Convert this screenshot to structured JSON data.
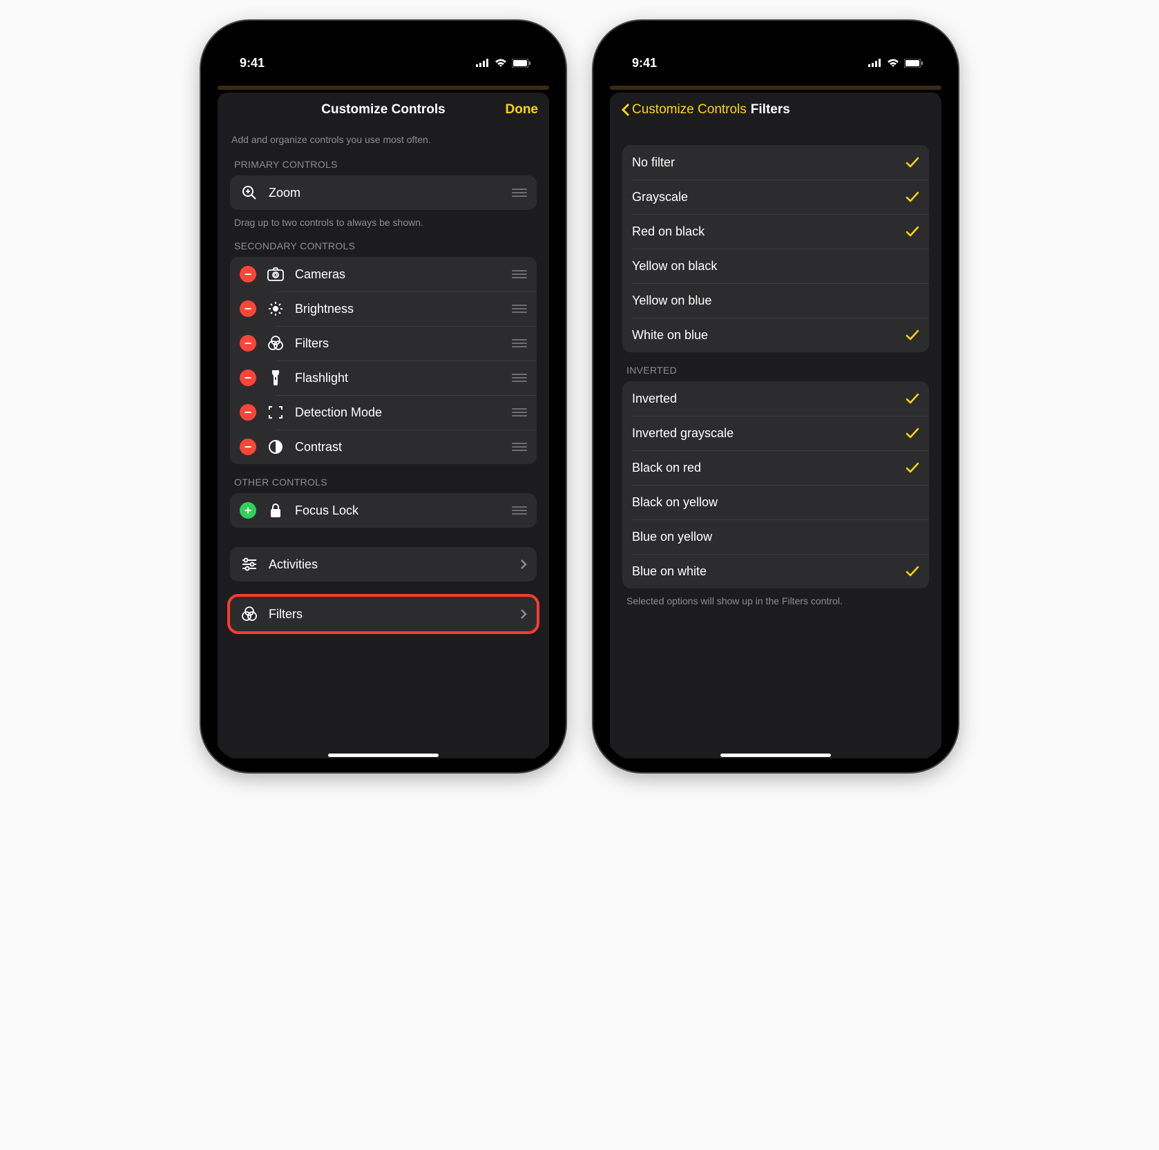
{
  "status": {
    "time": "9:41"
  },
  "left": {
    "title": "Customize Controls",
    "done": "Done",
    "intro": "Add and organize controls you use most often.",
    "primary": {
      "header": "PRIMARY CONTROLS",
      "item": "Zoom",
      "footer": "Drag up to two controls to always be shown."
    },
    "secondary": {
      "header": "SECONDARY CONTROLS",
      "items": [
        "Cameras",
        "Brightness",
        "Filters",
        "Flashlight",
        "Detection Mode",
        "Contrast"
      ]
    },
    "other": {
      "header": "OTHER CONTROLS",
      "item": "Focus Lock"
    },
    "activities": "Activities",
    "filters": "Filters"
  },
  "right": {
    "back": "Customize Controls",
    "title": "Filters",
    "group1": [
      {
        "label": "No filter",
        "checked": true
      },
      {
        "label": "Grayscale",
        "checked": true
      },
      {
        "label": "Red on black",
        "checked": true
      },
      {
        "label": "Yellow on black",
        "checked": false
      },
      {
        "label": "Yellow on blue",
        "checked": false
      },
      {
        "label": "White on blue",
        "checked": true
      }
    ],
    "invertedHeader": "INVERTED",
    "group2": [
      {
        "label": "Inverted",
        "checked": true
      },
      {
        "label": "Inverted grayscale",
        "checked": true
      },
      {
        "label": "Black on red",
        "checked": true
      },
      {
        "label": "Black on yellow",
        "checked": false
      },
      {
        "label": "Blue on yellow",
        "checked": false
      },
      {
        "label": "Blue on white",
        "checked": true
      }
    ],
    "footer": "Selected options will show up in the Filters control."
  }
}
